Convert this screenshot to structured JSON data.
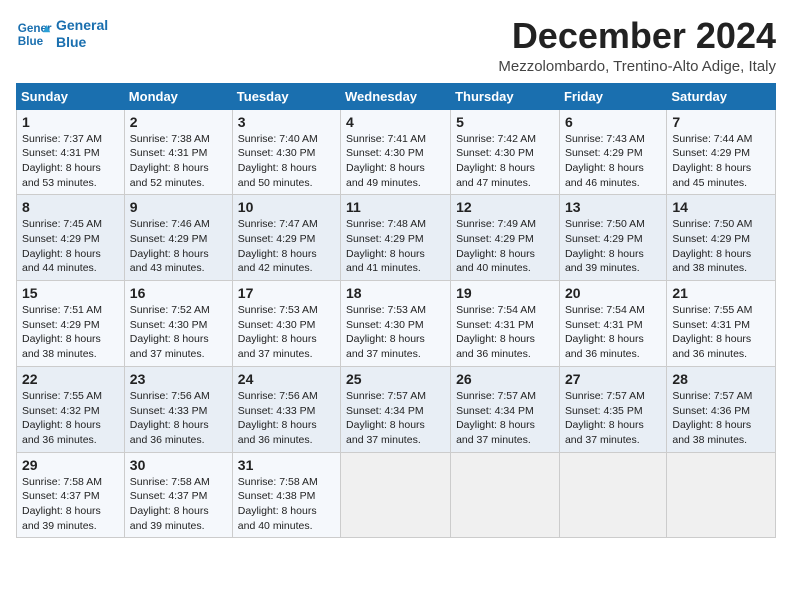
{
  "logo": {
    "line1": "General",
    "line2": "Blue"
  },
  "title": "December 2024",
  "location": "Mezzolombardo, Trentino-Alto Adige, Italy",
  "headers": [
    "Sunday",
    "Monday",
    "Tuesday",
    "Wednesday",
    "Thursday",
    "Friday",
    "Saturday"
  ],
  "weeks": [
    [
      {
        "day": "1",
        "text": "Sunrise: 7:37 AM\nSunset: 4:31 PM\nDaylight: 8 hours\nand 53 minutes."
      },
      {
        "day": "2",
        "text": "Sunrise: 7:38 AM\nSunset: 4:31 PM\nDaylight: 8 hours\nand 52 minutes."
      },
      {
        "day": "3",
        "text": "Sunrise: 7:40 AM\nSunset: 4:30 PM\nDaylight: 8 hours\nand 50 minutes."
      },
      {
        "day": "4",
        "text": "Sunrise: 7:41 AM\nSunset: 4:30 PM\nDaylight: 8 hours\nand 49 minutes."
      },
      {
        "day": "5",
        "text": "Sunrise: 7:42 AM\nSunset: 4:30 PM\nDaylight: 8 hours\nand 47 minutes."
      },
      {
        "day": "6",
        "text": "Sunrise: 7:43 AM\nSunset: 4:29 PM\nDaylight: 8 hours\nand 46 minutes."
      },
      {
        "day": "7",
        "text": "Sunrise: 7:44 AM\nSunset: 4:29 PM\nDaylight: 8 hours\nand 45 minutes."
      }
    ],
    [
      {
        "day": "8",
        "text": "Sunrise: 7:45 AM\nSunset: 4:29 PM\nDaylight: 8 hours\nand 44 minutes."
      },
      {
        "day": "9",
        "text": "Sunrise: 7:46 AM\nSunset: 4:29 PM\nDaylight: 8 hours\nand 43 minutes."
      },
      {
        "day": "10",
        "text": "Sunrise: 7:47 AM\nSunset: 4:29 PM\nDaylight: 8 hours\nand 42 minutes."
      },
      {
        "day": "11",
        "text": "Sunrise: 7:48 AM\nSunset: 4:29 PM\nDaylight: 8 hours\nand 41 minutes."
      },
      {
        "day": "12",
        "text": "Sunrise: 7:49 AM\nSunset: 4:29 PM\nDaylight: 8 hours\nand 40 minutes."
      },
      {
        "day": "13",
        "text": "Sunrise: 7:50 AM\nSunset: 4:29 PM\nDaylight: 8 hours\nand 39 minutes."
      },
      {
        "day": "14",
        "text": "Sunrise: 7:50 AM\nSunset: 4:29 PM\nDaylight: 8 hours\nand 38 minutes."
      }
    ],
    [
      {
        "day": "15",
        "text": "Sunrise: 7:51 AM\nSunset: 4:29 PM\nDaylight: 8 hours\nand 38 minutes."
      },
      {
        "day": "16",
        "text": "Sunrise: 7:52 AM\nSunset: 4:30 PM\nDaylight: 8 hours\nand 37 minutes."
      },
      {
        "day": "17",
        "text": "Sunrise: 7:53 AM\nSunset: 4:30 PM\nDaylight: 8 hours\nand 37 minutes."
      },
      {
        "day": "18",
        "text": "Sunrise: 7:53 AM\nSunset: 4:30 PM\nDaylight: 8 hours\nand 37 minutes."
      },
      {
        "day": "19",
        "text": "Sunrise: 7:54 AM\nSunset: 4:31 PM\nDaylight: 8 hours\nand 36 minutes."
      },
      {
        "day": "20",
        "text": "Sunrise: 7:54 AM\nSunset: 4:31 PM\nDaylight: 8 hours\nand 36 minutes."
      },
      {
        "day": "21",
        "text": "Sunrise: 7:55 AM\nSunset: 4:31 PM\nDaylight: 8 hours\nand 36 minutes."
      }
    ],
    [
      {
        "day": "22",
        "text": "Sunrise: 7:55 AM\nSunset: 4:32 PM\nDaylight: 8 hours\nand 36 minutes."
      },
      {
        "day": "23",
        "text": "Sunrise: 7:56 AM\nSunset: 4:33 PM\nDaylight: 8 hours\nand 36 minutes."
      },
      {
        "day": "24",
        "text": "Sunrise: 7:56 AM\nSunset: 4:33 PM\nDaylight: 8 hours\nand 36 minutes."
      },
      {
        "day": "25",
        "text": "Sunrise: 7:57 AM\nSunset: 4:34 PM\nDaylight: 8 hours\nand 37 minutes."
      },
      {
        "day": "26",
        "text": "Sunrise: 7:57 AM\nSunset: 4:34 PM\nDaylight: 8 hours\nand 37 minutes."
      },
      {
        "day": "27",
        "text": "Sunrise: 7:57 AM\nSunset: 4:35 PM\nDaylight: 8 hours\nand 37 minutes."
      },
      {
        "day": "28",
        "text": "Sunrise: 7:57 AM\nSunset: 4:36 PM\nDaylight: 8 hours\nand 38 minutes."
      }
    ],
    [
      {
        "day": "29",
        "text": "Sunrise: 7:58 AM\nSunset: 4:37 PM\nDaylight: 8 hours\nand 39 minutes."
      },
      {
        "day": "30",
        "text": "Sunrise: 7:58 AM\nSunset: 4:37 PM\nDaylight: 8 hours\nand 39 minutes."
      },
      {
        "day": "31",
        "text": "Sunrise: 7:58 AM\nSunset: 4:38 PM\nDaylight: 8 hours\nand 40 minutes."
      },
      {
        "day": "",
        "text": ""
      },
      {
        "day": "",
        "text": ""
      },
      {
        "day": "",
        "text": ""
      },
      {
        "day": "",
        "text": ""
      }
    ]
  ]
}
